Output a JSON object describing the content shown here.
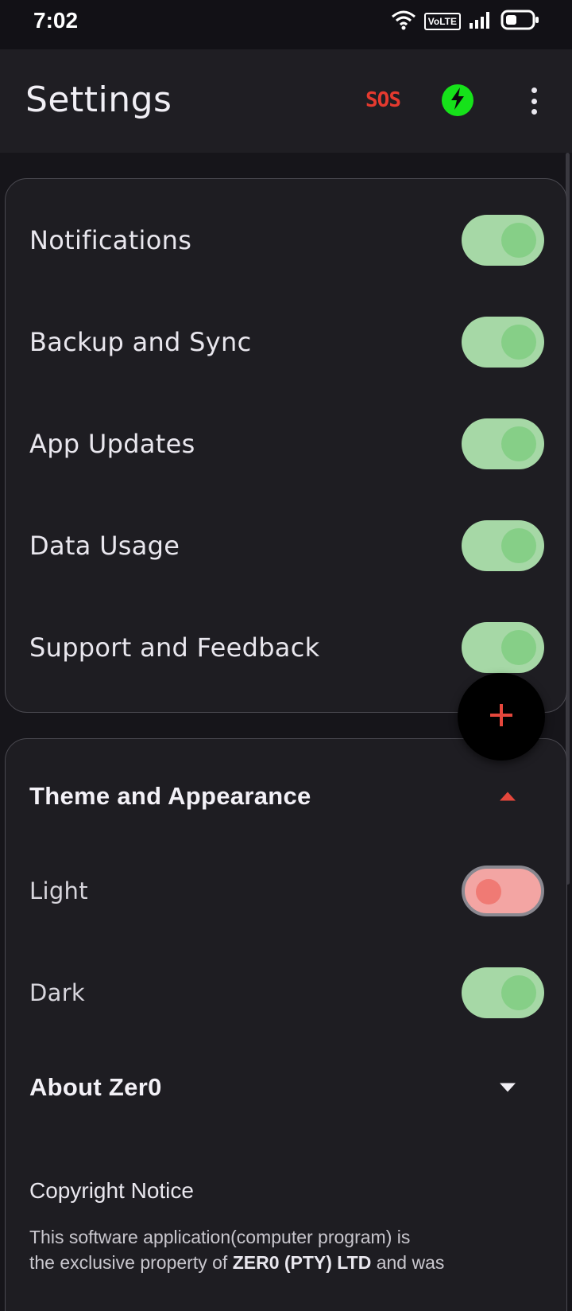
{
  "status_bar": {
    "time": "7:02",
    "volte": "VoLTE",
    "icons": [
      "wifi-icon",
      "volte-icon",
      "signal-icon",
      "battery-icon"
    ]
  },
  "app_bar": {
    "title": "Settings",
    "sos_label": "SOS",
    "icons": [
      "bolt-icon",
      "more-vert-icon"
    ],
    "colors": {
      "sos": "#e53a2f",
      "bolt_bg": "#16e21a"
    }
  },
  "toggles": [
    {
      "label": "Notifications",
      "on": true
    },
    {
      "label": "Backup and Sync",
      "on": true
    },
    {
      "label": "App Updates",
      "on": true
    },
    {
      "label": "Data Usage",
      "on": true
    },
    {
      "label": "Support and Feedback",
      "on": true
    }
  ],
  "fab": {
    "icon": "plus-icon",
    "color": "#e5473c"
  },
  "theme_section": {
    "title": "Theme and Appearance",
    "expanded": true,
    "options": [
      {
        "label": "Light",
        "on": false
      },
      {
        "label": "Dark",
        "on": true
      }
    ]
  },
  "about_section": {
    "title": "About Zer0",
    "expanded": false
  },
  "copyright": {
    "title": "Copyright Notice",
    "line1": "This software application(computer program) is",
    "line2_prefix": "the exclusive property of ",
    "line2_bold": "ZER0 (PTY) LTD",
    "line2_suffix": " and was"
  }
}
